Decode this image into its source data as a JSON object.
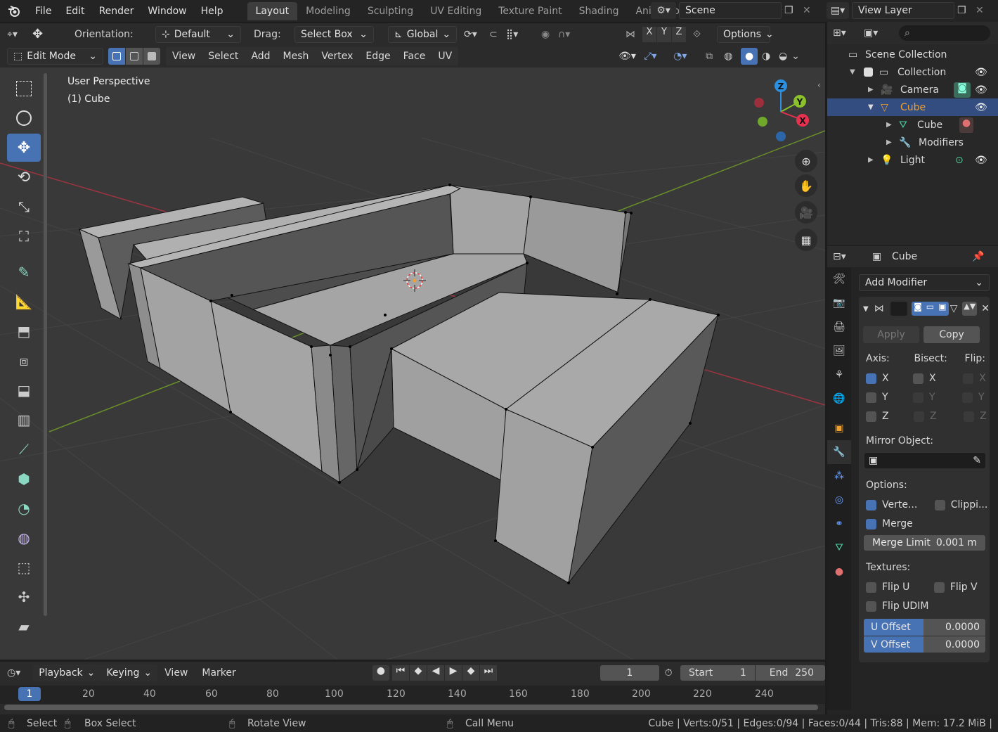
{
  "topbar": {
    "menus": [
      "File",
      "Edit",
      "Render",
      "Window",
      "Help"
    ],
    "workspaces": [
      "Layout",
      "Modeling",
      "Sculpting",
      "UV Editing",
      "Texture Paint",
      "Shading",
      "Animation"
    ],
    "active_workspace": "Layout",
    "scene": "Scene",
    "view_layer": "View Layer"
  },
  "tool_header": {
    "orientation_label": "Orientation:",
    "orientation_value": "Default",
    "drag_label": "Drag:",
    "drag_value": "Select Box",
    "transform_space": "Global",
    "options": "Options"
  },
  "viewport_header": {
    "mode": "Edit Mode",
    "menus": [
      "View",
      "Select",
      "Add",
      "Mesh",
      "Vertex",
      "Edge",
      "Face",
      "UV"
    ]
  },
  "viewport": {
    "view_name": "User Perspective",
    "object_name": "(1) Cube",
    "gizmo_axes": [
      "Z",
      "Y",
      "X"
    ]
  },
  "outliner": {
    "search_icon": "search-icon",
    "rows": [
      {
        "label": "Scene Collection",
        "icon": "scene-collection-icon"
      },
      {
        "label": "Collection",
        "icon": "collection-icon"
      },
      {
        "label": "Camera",
        "icon": "camera-icon"
      },
      {
        "label": "Cube",
        "icon": "mesh-object-icon"
      },
      {
        "label": "Cube",
        "icon": "mesh-data-icon"
      },
      {
        "label": "Modifiers",
        "icon": "wrench-icon"
      },
      {
        "label": "Light",
        "icon": "light-icon"
      }
    ]
  },
  "properties": {
    "object": "Cube",
    "add_modifier": "Add Modifier",
    "apply": "Apply",
    "copy": "Copy",
    "axis_label": "Axis:",
    "bisect_label": "Bisect:",
    "flip_label": "Flip:",
    "axes": [
      "X",
      "Y",
      "Z"
    ],
    "axis_checked": [
      true,
      false,
      false
    ],
    "mirror_object_label": "Mirror Object:",
    "options_label": "Options:",
    "vertex_groups": "Verte...",
    "clipping": "Clippi...",
    "merge": "Merge",
    "merge_limit_label": "Merge Limit",
    "merge_limit_value": "0.001 m",
    "textures_label": "Textures:",
    "flip_u": "Flip U",
    "flip_v": "Flip V",
    "flip_udim": "Flip UDIM",
    "u_offset_label": "U Offset",
    "u_offset_value": "0.0000",
    "v_offset_label": "V Offset",
    "v_offset_value": "0.0000"
  },
  "timeline": {
    "menus": [
      "Playback",
      "Keying",
      "View",
      "Marker"
    ],
    "current_frame": "1",
    "start_label": "Start",
    "start_value": "1",
    "end_label": "End",
    "end_value": "250",
    "ruler": [
      "1",
      "20",
      "40",
      "60",
      "80",
      "100",
      "120",
      "140",
      "160",
      "180",
      "200",
      "220",
      "240"
    ]
  },
  "statusbar": {
    "select": "Select",
    "box_select": "Box Select",
    "rotate_view": "Rotate View",
    "call_menu": "Call Menu",
    "stats": "Cube | Verts:0/51 | Edges:0/94 | Faces:0/44 | Tris:88 | Mem: 17.2 MiB |"
  },
  "colors": {
    "accent": "#4772b3",
    "selected_row": "#334d80",
    "mesh_face": "#a8a8a8",
    "axis_x": "#e8304f",
    "axis_y": "#8bc22b",
    "axis_z": "#2c8fdf"
  }
}
